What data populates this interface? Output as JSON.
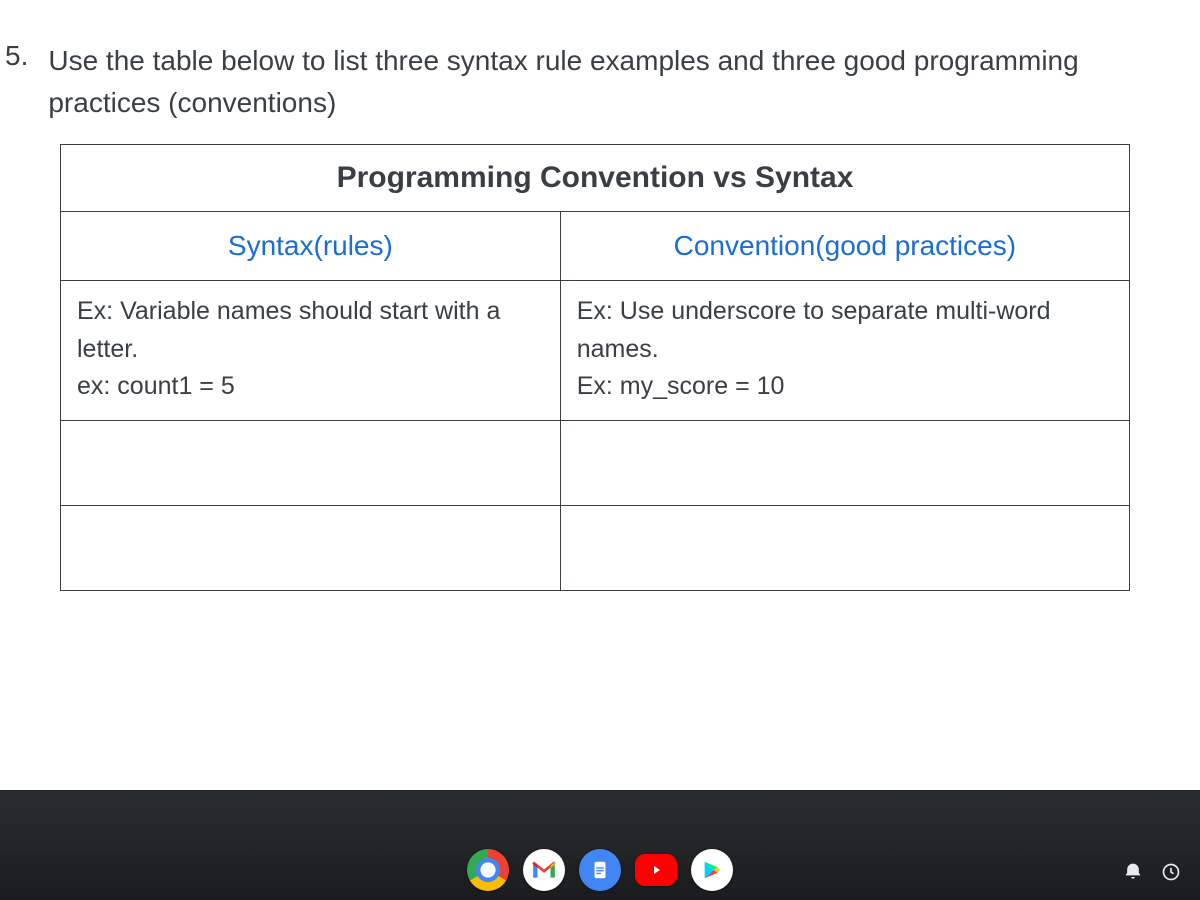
{
  "question": {
    "number": "5.",
    "text": "Use the table below to list three syntax rule examples and three good programming practices (conventions)"
  },
  "table": {
    "title": "Programming Convention vs Syntax",
    "headers": {
      "left": "Syntax(rules)",
      "right": "Convention(good practices)"
    },
    "example_row": {
      "syntax": {
        "line1": "Ex: Variable names should start with a letter.",
        "line2": "ex: count1 = 5"
      },
      "convention": {
        "line1": "Ex: Use underscore to separate multi-word names.",
        "line2": "Ex: my_score = 10"
      }
    }
  },
  "taskbar": {
    "icons": {
      "chrome": "chrome-icon",
      "gmail": "gmail-icon",
      "docs": "docs-icon",
      "youtube": "youtube-icon",
      "play": "play-store-icon"
    }
  }
}
